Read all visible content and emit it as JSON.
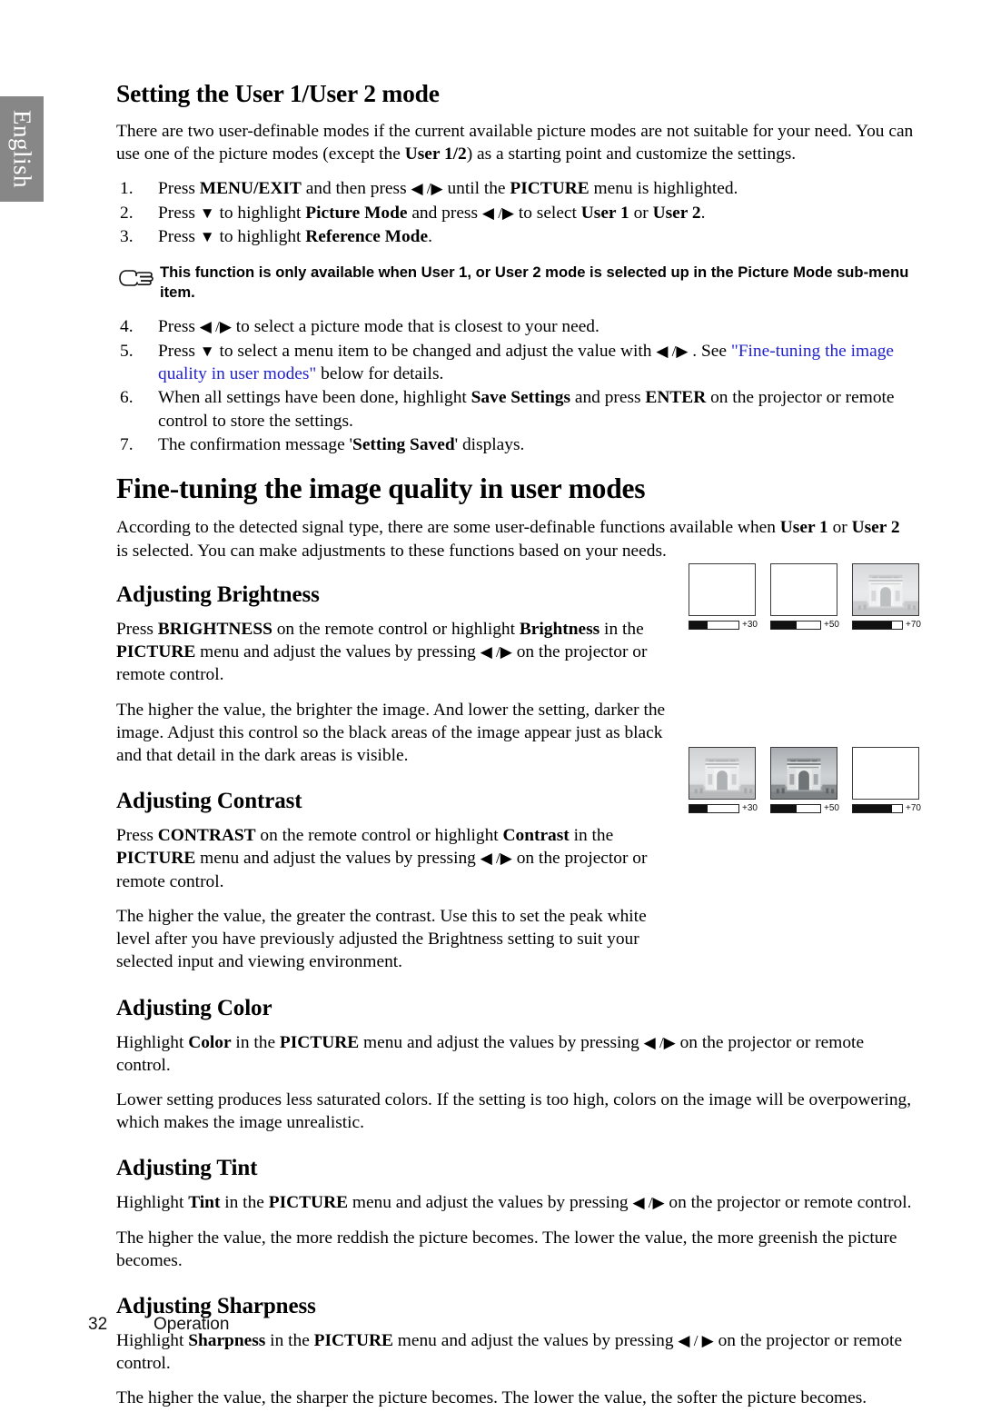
{
  "language_tab": {
    "label": "English"
  },
  "section1": {
    "title": "Setting the User 1/User 2 mode",
    "intro_a": "There are two user-definable modes if the current available picture modes are not suitable for your need. You can use one of the picture modes (except the ",
    "intro_b": "User 1/2",
    "intro_c": ") as a starting point and customize the settings.",
    "steps": [
      {
        "num": "1.",
        "parts": [
          {
            "t": "Press ",
            "style": "normal"
          },
          {
            "t": "MENU/EXIT",
            "style": "bold"
          },
          {
            "t": " and then press ",
            "style": "normal"
          },
          {
            "t": "◀ /▶",
            "style": "arrow"
          },
          {
            "t": " until the ",
            "style": "normal"
          },
          {
            "t": "PICTURE",
            "style": "bold"
          },
          {
            "t": " menu is highlighted.",
            "style": "normal"
          }
        ]
      },
      {
        "num": "2.",
        "parts": [
          {
            "t": "Press ",
            "style": "normal"
          },
          {
            "t": "▼",
            "style": "arrow"
          },
          {
            "t": " to highlight ",
            "style": "normal"
          },
          {
            "t": "Picture Mode",
            "style": "bold"
          },
          {
            "t": " and press ",
            "style": "normal"
          },
          {
            "t": "◀ /▶",
            "style": "arrow"
          },
          {
            "t": " to select ",
            "style": "normal"
          },
          {
            "t": "User 1",
            "style": "bold"
          },
          {
            "t": " or ",
            "style": "normal"
          },
          {
            "t": "User 2",
            "style": "bold"
          },
          {
            "t": ".",
            "style": "normal"
          }
        ]
      },
      {
        "num": "3.",
        "parts": [
          {
            "t": "Press ",
            "style": "normal"
          },
          {
            "t": "▼",
            "style": "arrow"
          },
          {
            "t": " to highlight ",
            "style": "normal"
          },
          {
            "t": "Reference Mode",
            "style": "bold"
          },
          {
            "t": ".",
            "style": "normal"
          }
        ]
      }
    ],
    "note": {
      "icon": "pointing-hand-icon",
      "text": "This function is only available when User 1, or User 2 mode is selected up in the Picture Mode sub-menu item."
    },
    "steps2": [
      {
        "num": "4.",
        "parts": [
          {
            "t": "Press ",
            "style": "normal"
          },
          {
            "t": "◀ /▶",
            "style": "arrow"
          },
          {
            "t": " to select a picture mode that is closest to your need.",
            "style": "normal"
          }
        ]
      },
      {
        "num": "5.",
        "parts": [
          {
            "t": "Press ",
            "style": "normal"
          },
          {
            "t": "▼",
            "style": "arrow"
          },
          {
            "t": " to select a menu item to be changed and adjust the value with ",
            "style": "normal"
          },
          {
            "t": "◀ /▶",
            "style": "arrow"
          },
          {
            "t": " . See ",
            "style": "normal"
          },
          {
            "t": "\"Fine-tuning the image quality in user modes\"",
            "style": "link"
          },
          {
            "t": " below for details.",
            "style": "normal"
          }
        ]
      },
      {
        "num": "6.",
        "parts": [
          {
            "t": "When all settings have been done, highlight ",
            "style": "normal"
          },
          {
            "t": "Save Settings",
            "style": "bold"
          },
          {
            "t": " and press ",
            "style": "normal"
          },
          {
            "t": "ENTER",
            "style": "bold"
          },
          {
            "t": " on the projector or remote control to store the settings.",
            "style": "normal"
          }
        ]
      },
      {
        "num": "7.",
        "parts": [
          {
            "t": "The confirmation message '",
            "style": "normal"
          },
          {
            "t": "Setting Saved",
            "style": "bold"
          },
          {
            "t": "' displays.",
            "style": "normal"
          }
        ]
      }
    ]
  },
  "section2": {
    "title": "Fine-tuning the image quality in user modes",
    "intro_parts": [
      {
        "t": "According to the detected signal type, there are some user-definable functions available when ",
        "style": "normal"
      },
      {
        "t": "User 1",
        "style": "bold"
      },
      {
        "t": " or ",
        "style": "normal"
      },
      {
        "t": "User 2",
        "style": "bold"
      },
      {
        "t": " is selected. You can make adjustments to these functions based on your needs.",
        "style": "normal"
      }
    ],
    "brightness": {
      "title": "Adjusting Brightness",
      "p1_parts": [
        {
          "t": "Press ",
          "style": "normal"
        },
        {
          "t": "BRIGHTNESS",
          "style": "bold"
        },
        {
          "t": " on the remote control or highlight ",
          "style": "normal"
        },
        {
          "t": "Brightness",
          "style": "bold"
        },
        {
          "t": " in the ",
          "style": "normal"
        },
        {
          "t": "PICTURE",
          "style": "bold"
        },
        {
          "t": " menu and adjust the values by pressing ",
          "style": "normal"
        },
        {
          "t": "◀ /▶",
          "style": "arrow"
        },
        {
          "t": " on the projector or remote control.",
          "style": "normal"
        }
      ],
      "p2": "The higher the value, the brighter the image. And lower the setting, darker the image. Adjust this control so the black areas of the image appear just as black and that detail in the dark areas is visible.",
      "figures": [
        {
          "value": "+30",
          "fill_pct": 37,
          "image": "arc-de-triomphe-thumbnail",
          "image_visibility": 0
        },
        {
          "value": "+50",
          "fill_pct": 52,
          "image": "arc-de-triomphe-thumbnail",
          "image_visibility": 0
        },
        {
          "value": "+70",
          "fill_pct": 80,
          "image": "arc-de-triomphe-thumbnail",
          "image_visibility": 0.45
        }
      ]
    },
    "contrast": {
      "title": "Adjusting Contrast",
      "p1_parts": [
        {
          "t": "Press ",
          "style": "normal"
        },
        {
          "t": "CONTRAST",
          "style": "bold"
        },
        {
          "t": " on the remote control or highlight ",
          "style": "normal"
        },
        {
          "t": "Contrast",
          "style": "bold"
        },
        {
          "t": " in the ",
          "style": "normal"
        },
        {
          "t": "PICTURE",
          "style": "bold"
        },
        {
          "t": " menu and adjust the values by pressing ",
          "style": "normal"
        },
        {
          "t": "◀ /▶",
          "style": "arrow"
        },
        {
          "t": " on the projector or remote control.",
          "style": "normal"
        }
      ],
      "p2": "The higher the value, the greater the contrast. Use this to set the peak white level after you have previously adjusted the Brightness setting to suit your selected input and viewing environment.",
      "figures": [
        {
          "value": "+30",
          "fill_pct": 37,
          "image": "arc-de-triomphe-thumbnail",
          "image_visibility": 0.55
        },
        {
          "value": "+50",
          "fill_pct": 52,
          "image": "arc-de-triomphe-thumbnail",
          "image_visibility": 1.0
        },
        {
          "value": "+70",
          "fill_pct": 80,
          "image": "arc-de-triomphe-thumbnail",
          "image_visibility": 0
        }
      ]
    },
    "color": {
      "title": "Adjusting Color",
      "p1_parts": [
        {
          "t": "Highlight ",
          "style": "normal"
        },
        {
          "t": "Color",
          "style": "bold"
        },
        {
          "t": " in the ",
          "style": "normal"
        },
        {
          "t": "PICTURE",
          "style": "bold"
        },
        {
          "t": " menu and adjust the values by pressing ",
          "style": "normal"
        },
        {
          "t": "◀ /▶",
          "style": "arrow"
        },
        {
          "t": " on the projector or remote control.",
          "style": "normal"
        }
      ],
      "p2": "Lower setting produces less saturated colors. If the setting is too high, colors on the image will be overpowering, which makes the image unrealistic."
    },
    "tint": {
      "title": "Adjusting Tint",
      "p1_parts": [
        {
          "t": "Highlight ",
          "style": "normal"
        },
        {
          "t": "Tint",
          "style": "bold"
        },
        {
          "t": " in the ",
          "style": "normal"
        },
        {
          "t": "PICTURE",
          "style": "bold"
        },
        {
          "t": " menu and adjust the values by pressing ",
          "style": "normal"
        },
        {
          "t": "◀ /▶",
          "style": "arrow"
        },
        {
          "t": " on the projector or remote control.",
          "style": "normal"
        }
      ],
      "p2": "The higher the value, the more reddish the picture becomes. The lower the value, the more greenish the picture becomes."
    },
    "sharpness": {
      "title": "Adjusting Sharpness",
      "p1_parts": [
        {
          "t": "Highlight ",
          "style": "normal"
        },
        {
          "t": "Sharpness",
          "style": "bold"
        },
        {
          "t": " in the ",
          "style": "normal"
        },
        {
          "t": "PICTURE",
          "style": "bold"
        },
        {
          "t": " menu and adjust the values by pressing ",
          "style": "normal"
        },
        {
          "t": "◀ / ▶",
          "style": "arrow"
        },
        {
          "t": " on the projector or remote control.",
          "style": "normal"
        }
      ],
      "p2": "The higher the value, the sharper the picture becomes. The lower the value, the softer the picture becomes."
    }
  },
  "footer": {
    "page_number": "32",
    "chapter": "Operation"
  },
  "colors": {
    "link": "#2222cc",
    "tab_bg": "#878787",
    "text": "#000000"
  }
}
